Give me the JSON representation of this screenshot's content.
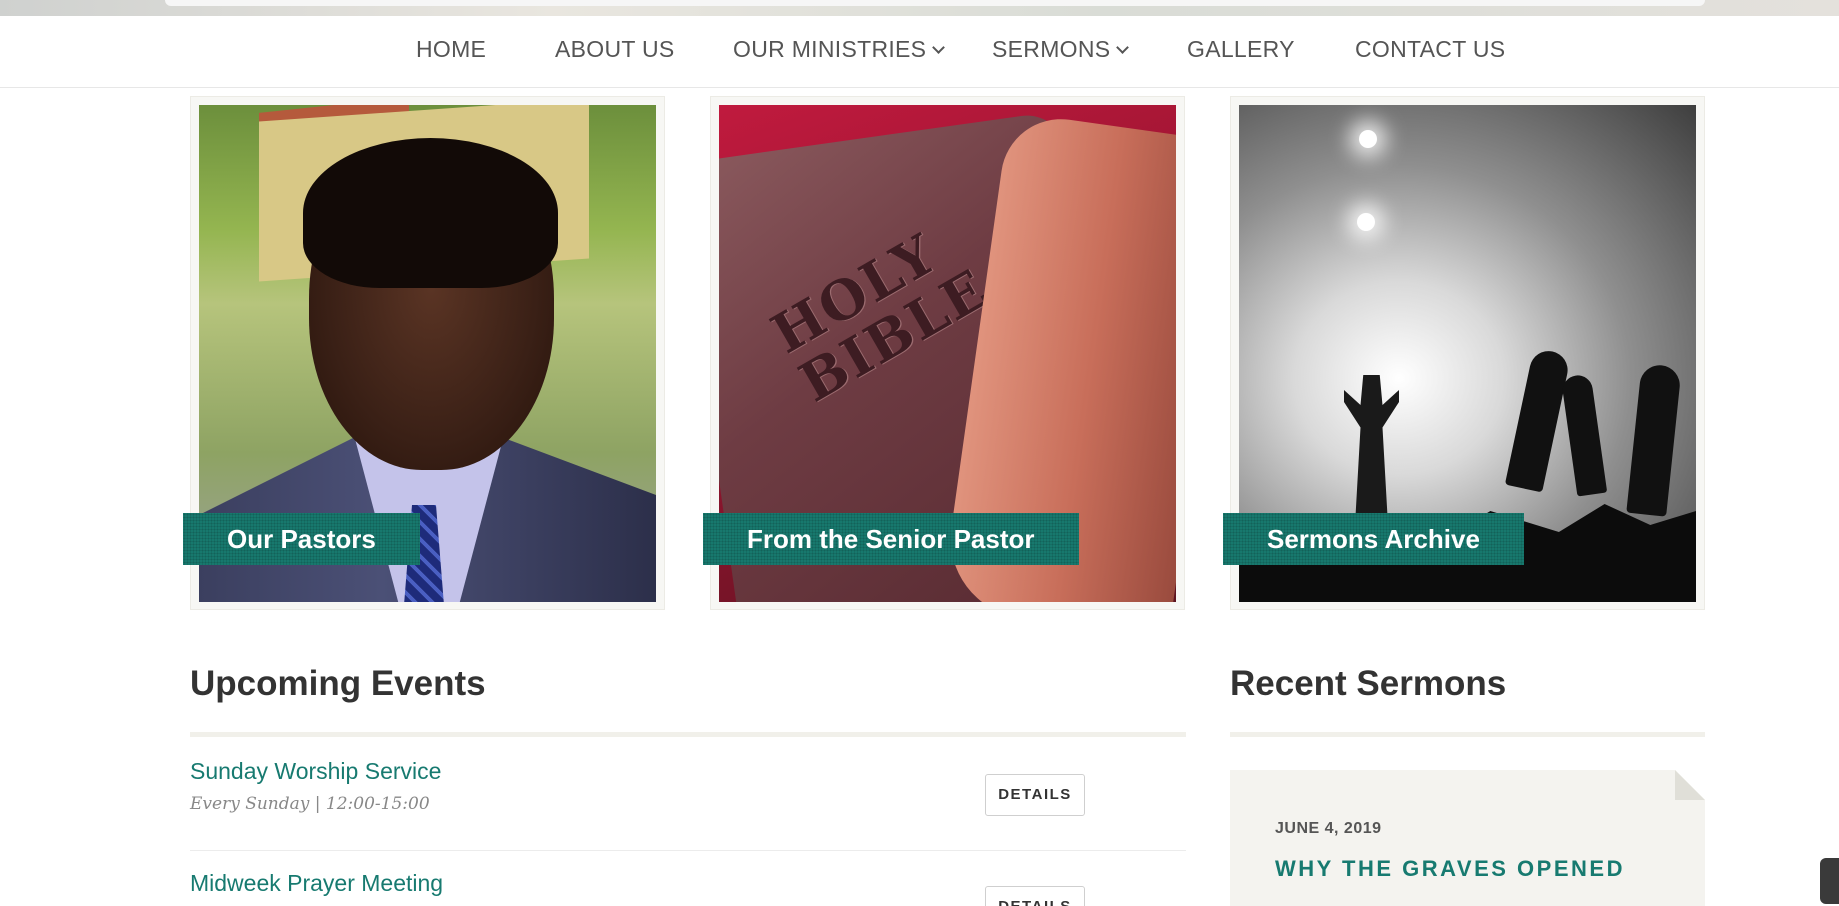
{
  "nav": {
    "items": [
      {
        "label": "HOME",
        "dropdown": false
      },
      {
        "label": "ABOUT US",
        "dropdown": false
      },
      {
        "label": "OUR MINISTRIES",
        "dropdown": true
      },
      {
        "label": "SERMONS",
        "dropdown": true
      },
      {
        "label": "GALLERY",
        "dropdown": false
      },
      {
        "label": "CONTACT US",
        "dropdown": false
      }
    ]
  },
  "features": [
    {
      "label": "Our Pastors"
    },
    {
      "label": "From the Senior Pastor"
    },
    {
      "label": "Sermons Archive"
    }
  ],
  "bible_cover_text": "HOLY\nBIBLE",
  "events": {
    "title": "Upcoming Events",
    "items": [
      {
        "title": "Sunday Worship Service",
        "meta": "Every Sunday | 12:00-15:00",
        "button": "DETAILS"
      },
      {
        "title": "Midweek Prayer Meeting",
        "meta": "",
        "button": "DETAILS"
      }
    ]
  },
  "sermons": {
    "title": "Recent Sermons",
    "latest": {
      "date": "JUNE 4, 2019",
      "title": "WHY THE GRAVES OPENED"
    }
  },
  "colors": {
    "accent": "#177a70",
    "label_bg": "#17786d",
    "text": "#333333"
  }
}
